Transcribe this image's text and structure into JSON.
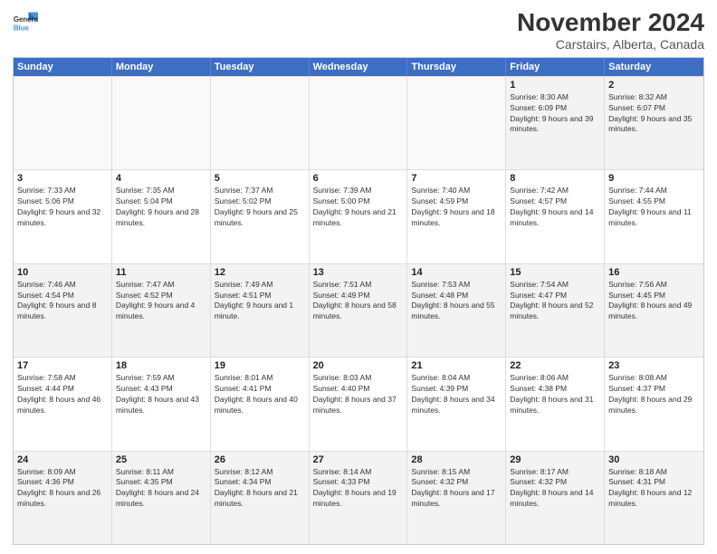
{
  "header": {
    "logo_line1": "General",
    "logo_line2": "Blue",
    "title": "November 2024",
    "subtitle": "Carstairs, Alberta, Canada"
  },
  "days_of_week": [
    "Sunday",
    "Monday",
    "Tuesday",
    "Wednesday",
    "Thursday",
    "Friday",
    "Saturday"
  ],
  "weeks": [
    [
      {
        "day": "",
        "info": ""
      },
      {
        "day": "",
        "info": ""
      },
      {
        "day": "",
        "info": ""
      },
      {
        "day": "",
        "info": ""
      },
      {
        "day": "",
        "info": ""
      },
      {
        "day": "1",
        "info": "Sunrise: 8:30 AM\nSunset: 6:09 PM\nDaylight: 9 hours and 39 minutes."
      },
      {
        "day": "2",
        "info": "Sunrise: 8:32 AM\nSunset: 6:07 PM\nDaylight: 9 hours and 35 minutes."
      }
    ],
    [
      {
        "day": "3",
        "info": "Sunrise: 7:33 AM\nSunset: 5:06 PM\nDaylight: 9 hours and 32 minutes."
      },
      {
        "day": "4",
        "info": "Sunrise: 7:35 AM\nSunset: 5:04 PM\nDaylight: 9 hours and 28 minutes."
      },
      {
        "day": "5",
        "info": "Sunrise: 7:37 AM\nSunset: 5:02 PM\nDaylight: 9 hours and 25 minutes."
      },
      {
        "day": "6",
        "info": "Sunrise: 7:39 AM\nSunset: 5:00 PM\nDaylight: 9 hours and 21 minutes."
      },
      {
        "day": "7",
        "info": "Sunrise: 7:40 AM\nSunset: 4:59 PM\nDaylight: 9 hours and 18 minutes."
      },
      {
        "day": "8",
        "info": "Sunrise: 7:42 AM\nSunset: 4:57 PM\nDaylight: 9 hours and 14 minutes."
      },
      {
        "day": "9",
        "info": "Sunrise: 7:44 AM\nSunset: 4:55 PM\nDaylight: 9 hours and 11 minutes."
      }
    ],
    [
      {
        "day": "10",
        "info": "Sunrise: 7:46 AM\nSunset: 4:54 PM\nDaylight: 9 hours and 8 minutes."
      },
      {
        "day": "11",
        "info": "Sunrise: 7:47 AM\nSunset: 4:52 PM\nDaylight: 9 hours and 4 minutes."
      },
      {
        "day": "12",
        "info": "Sunrise: 7:49 AM\nSunset: 4:51 PM\nDaylight: 9 hours and 1 minute."
      },
      {
        "day": "13",
        "info": "Sunrise: 7:51 AM\nSunset: 4:49 PM\nDaylight: 8 hours and 58 minutes."
      },
      {
        "day": "14",
        "info": "Sunrise: 7:53 AM\nSunset: 4:48 PM\nDaylight: 8 hours and 55 minutes."
      },
      {
        "day": "15",
        "info": "Sunrise: 7:54 AM\nSunset: 4:47 PM\nDaylight: 8 hours and 52 minutes."
      },
      {
        "day": "16",
        "info": "Sunrise: 7:56 AM\nSunset: 4:45 PM\nDaylight: 8 hours and 49 minutes."
      }
    ],
    [
      {
        "day": "17",
        "info": "Sunrise: 7:58 AM\nSunset: 4:44 PM\nDaylight: 8 hours and 46 minutes."
      },
      {
        "day": "18",
        "info": "Sunrise: 7:59 AM\nSunset: 4:43 PM\nDaylight: 8 hours and 43 minutes."
      },
      {
        "day": "19",
        "info": "Sunrise: 8:01 AM\nSunset: 4:41 PM\nDaylight: 8 hours and 40 minutes."
      },
      {
        "day": "20",
        "info": "Sunrise: 8:03 AM\nSunset: 4:40 PM\nDaylight: 8 hours and 37 minutes."
      },
      {
        "day": "21",
        "info": "Sunrise: 8:04 AM\nSunset: 4:39 PM\nDaylight: 8 hours and 34 minutes."
      },
      {
        "day": "22",
        "info": "Sunrise: 8:06 AM\nSunset: 4:38 PM\nDaylight: 8 hours and 31 minutes."
      },
      {
        "day": "23",
        "info": "Sunrise: 8:08 AM\nSunset: 4:37 PM\nDaylight: 8 hours and 29 minutes."
      }
    ],
    [
      {
        "day": "24",
        "info": "Sunrise: 8:09 AM\nSunset: 4:36 PM\nDaylight: 8 hours and 26 minutes."
      },
      {
        "day": "25",
        "info": "Sunrise: 8:11 AM\nSunset: 4:35 PM\nDaylight: 8 hours and 24 minutes."
      },
      {
        "day": "26",
        "info": "Sunrise: 8:12 AM\nSunset: 4:34 PM\nDaylight: 8 hours and 21 minutes."
      },
      {
        "day": "27",
        "info": "Sunrise: 8:14 AM\nSunset: 4:33 PM\nDaylight: 8 hours and 19 minutes."
      },
      {
        "day": "28",
        "info": "Sunrise: 8:15 AM\nSunset: 4:32 PM\nDaylight: 8 hours and 17 minutes."
      },
      {
        "day": "29",
        "info": "Sunrise: 8:17 AM\nSunset: 4:32 PM\nDaylight: 8 hours and 14 minutes."
      },
      {
        "day": "30",
        "info": "Sunrise: 8:18 AM\nSunset: 4:31 PM\nDaylight: 8 hours and 12 minutes."
      }
    ]
  ]
}
